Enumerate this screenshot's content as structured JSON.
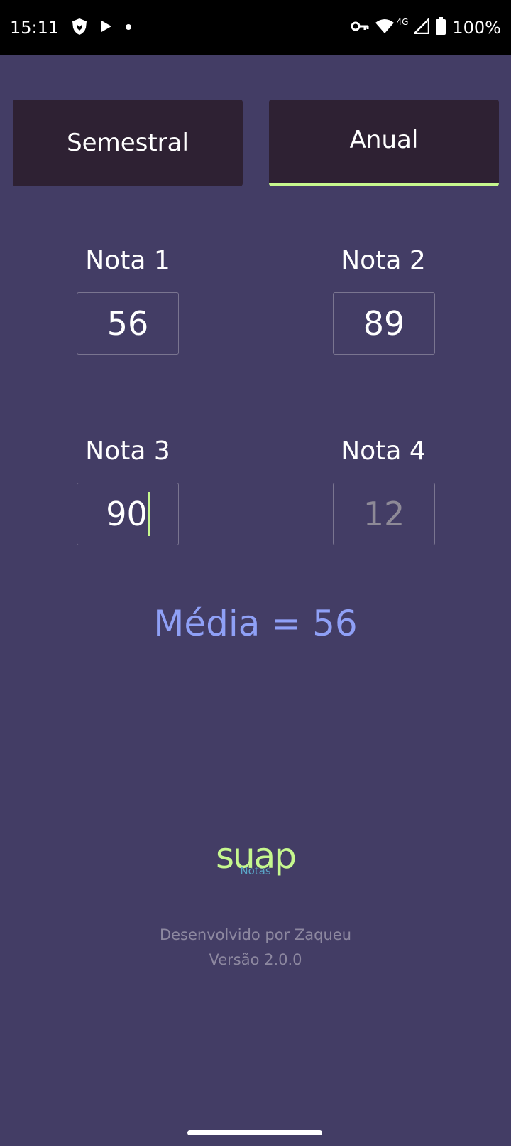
{
  "status_bar": {
    "time": "15:11",
    "network": "4G",
    "battery": "100%"
  },
  "tabs": [
    {
      "label": "Semestral",
      "selected": false
    },
    {
      "label": "Anual",
      "selected": true
    }
  ],
  "grades": [
    {
      "label": "Nota 1",
      "value": "56",
      "placeholder": ""
    },
    {
      "label": "Nota 2",
      "value": "89",
      "placeholder": ""
    },
    {
      "label": "Nota 3",
      "value": "90",
      "placeholder": ""
    },
    {
      "label": "Nota 4",
      "value": "",
      "placeholder": "12"
    }
  ],
  "result": {
    "text": "Média = 56"
  },
  "footer": {
    "logo_main": "suap",
    "logo_sub": "Notas",
    "developer": "Desenvolvido por Zaqueu",
    "version": "Versão 2.0.0"
  },
  "colors": {
    "background": "#433d65",
    "tab_background": "#2e2133",
    "accent": "#c6f88e",
    "result_text": "#8fa0f6",
    "muted_text": "#8d88a0"
  }
}
